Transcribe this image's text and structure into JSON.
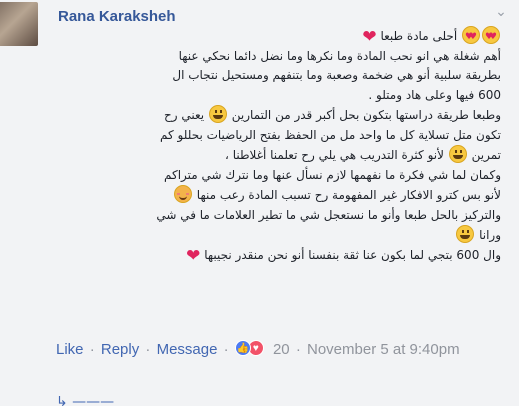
{
  "comment": {
    "author": "Rana Karaksheh",
    "options_icon": "chevron-down-icon",
    "lines": [
      {
        "text": "أحلى مادة طبعا",
        "emojis": [
          "heart-eyes",
          "heart-eyes"
        ],
        "heart": true
      },
      {
        "text": "أهم شغلة هي انو نحب المادة وما نكرها وما نضل دائما نحكي عنها"
      },
      {
        "text": "بطريقة سلبية أنو هي ضخمة وصعبة وما بتنفهم ومستحيل نتجاب ال"
      },
      {
        "text": "600 فيها وعلى هاد ومتلو ."
      },
      {
        "text": "وطبعا طريقة دراستها بتكون بحل أكبر قدر من التمارين",
        "emoji_after": "grin",
        "tail": "يعني رح"
      },
      {
        "text": "تكون متل تسلاية كل ما واحد مل من الحفظ بفتح الرياضيات بحللو كم"
      },
      {
        "text": "تمرين",
        "emoji_after": "grin",
        "tail": "لأنو كثرة التدريب هي يلي رح تعلمنا أغلاطنا ،"
      },
      {
        "text": "وكمان لما شي فكرة ما نفهمها لازم نسأل عنها وما نترك شي متراكم"
      },
      {
        "text": "لأنو بس كترو الافكار غير المفهومة رح تسبب المادة رعب منها",
        "emoji_after": "blush"
      },
      {
        "text": "والتركيز بالحل طبعا وأنو ما نستعجل شي ما تطير العلامات ما في شي"
      },
      {
        "text": "ورانا",
        "emoji_after": "grin"
      },
      {
        "text": "وال 600 بتجي لما بكون عنا ثقة بنفسنا أنو نحن منقدر نجيبها",
        "heart": true
      }
    ]
  },
  "actions": {
    "like_label": "Like",
    "reply_label": "Reply",
    "message_label": "Message",
    "separator": "·",
    "reaction_count": "20",
    "timestamp": "November 5 at 9:40pm",
    "reaction_icons": [
      "like-reaction-icon",
      "love-reaction-icon"
    ]
  },
  "colors": {
    "background": "#f2f3f5",
    "author": "#365899",
    "link": "#4267b2",
    "meta": "#90949c",
    "text": "#1d2129",
    "heart": "#e0245e"
  }
}
